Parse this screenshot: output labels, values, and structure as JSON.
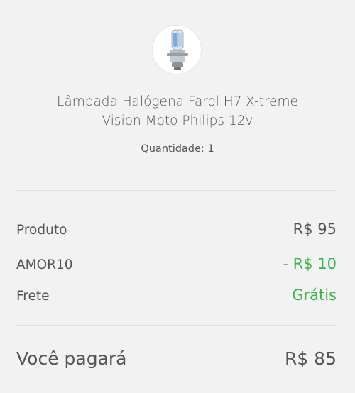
{
  "product": {
    "image_icon": "headlight-bulb-icon",
    "title": "Lâmpada Halógena Farol H7 X-treme Vision Moto Philips 12v",
    "quantity_text": "Quantidade: 1"
  },
  "summary": {
    "product_label": "Produto",
    "product_value": "R$ 95",
    "coupon_label": "AMOR10",
    "coupon_value": "- R$ 10",
    "shipping_label": "Frete",
    "shipping_value": "Grátis",
    "total_label": "Você pagará",
    "total_value": "R$ 85"
  },
  "colors": {
    "background": "#f2f2f2",
    "text": "#555555",
    "discount_green": "#39b54a",
    "divider": "#e0e0e0"
  }
}
